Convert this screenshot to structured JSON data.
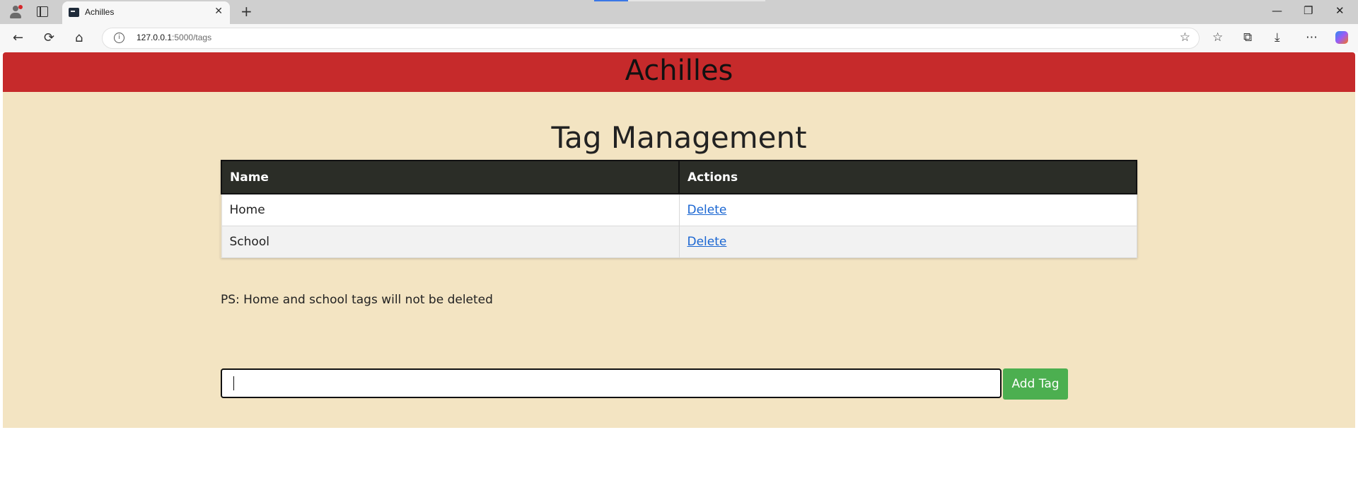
{
  "browser": {
    "tab": {
      "title": "Achilles",
      "close_glyph": "✕",
      "new_tab_glyph": "+"
    },
    "window_controls": {
      "minimize": "—",
      "restore": "❐",
      "close": "✕"
    },
    "url": {
      "host": "127.0.0.1",
      "path": ":5000/tags"
    },
    "icons": [
      "back-icon",
      "reload-icon",
      "home-icon",
      "info-icon",
      "star-icon",
      "favorites-icon",
      "collections-icon",
      "download-icon",
      "more-icon",
      "copilot-icon"
    ]
  },
  "site": {
    "title": "Achilles",
    "header_color": "#c62a2b",
    "background_color": "#f3e4c2"
  },
  "page": {
    "heading": "Tag Management",
    "table": {
      "headers": [
        "Name",
        "Actions"
      ],
      "rows": [
        {
          "name": "Home",
          "action": "Delete"
        },
        {
          "name": "School",
          "action": "Delete"
        }
      ]
    },
    "note": "PS: Home and school tags will not be deleted",
    "tag_input": {
      "value": "",
      "placeholder": ""
    },
    "add_button": {
      "label": "Add Tag",
      "color": "#4caf50"
    }
  }
}
